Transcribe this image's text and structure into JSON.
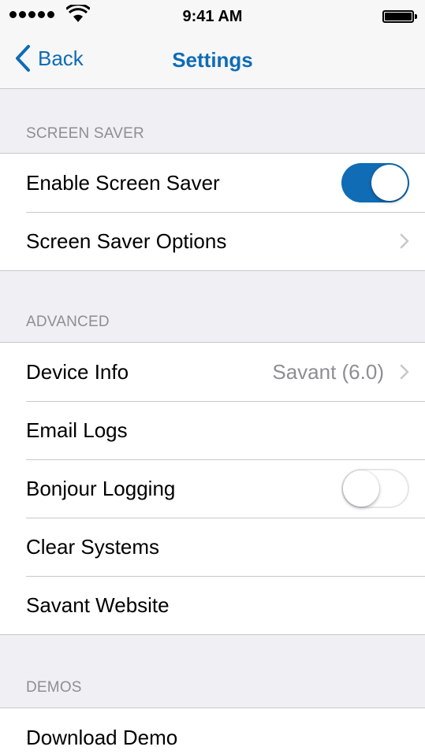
{
  "status_bar": {
    "time": "9:41 AM"
  },
  "nav": {
    "back_label": "Back",
    "title": "Settings",
    "accent": "#0f6cb5"
  },
  "sections": [
    {
      "header": "SCREEN SAVER",
      "rows": [
        {
          "label": "Enable Screen Saver",
          "toggle": true
        },
        {
          "label": "Screen Saver Options",
          "chevron": true
        }
      ]
    },
    {
      "header": "ADVANCED",
      "rows": [
        {
          "label": "Device Info",
          "detail": "Savant (6.0)",
          "chevron": true
        },
        {
          "label": "Email Logs"
        },
        {
          "label": "Bonjour Logging",
          "toggle": false
        },
        {
          "label": "Clear Systems"
        },
        {
          "label": "Savant Website"
        }
      ]
    },
    {
      "header": "DEMOS",
      "rows": [
        {
          "label": "Download Demo"
        }
      ]
    }
  ]
}
